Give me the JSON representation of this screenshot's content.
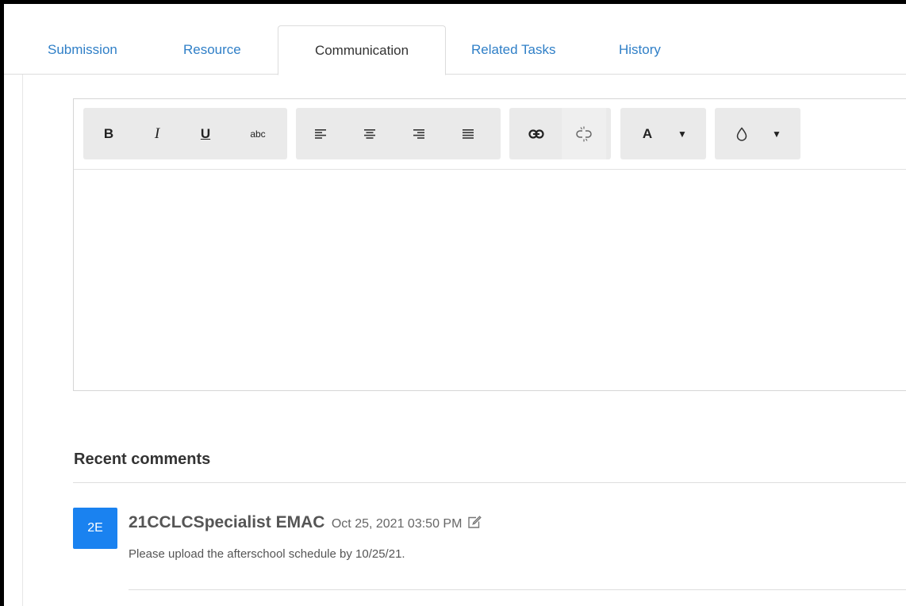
{
  "tabs": [
    {
      "label": "Submission",
      "active": false
    },
    {
      "label": "Resource",
      "active": false
    },
    {
      "label": "Communication",
      "active": true
    },
    {
      "label": "Related Tasks",
      "active": false
    },
    {
      "label": "History",
      "active": false
    }
  ],
  "toolbar": {
    "bold": "B",
    "italic": "I",
    "underline": "U",
    "strikethrough": "abc",
    "font_color": "A",
    "dropdown_arrow": "▼"
  },
  "comments_section": {
    "title": "Recent comments",
    "comments": [
      {
        "avatar_initials": "2E",
        "author": "21CCLCSpecialist EMAC",
        "timestamp": "Oct 25, 2021 03:50 PM",
        "text": "Please upload the afterschool schedule by 10/25/21."
      }
    ]
  },
  "colors": {
    "link": "#2f7fc7",
    "avatar": "#1a82f0",
    "toolbar_group": "#eaeaea"
  }
}
